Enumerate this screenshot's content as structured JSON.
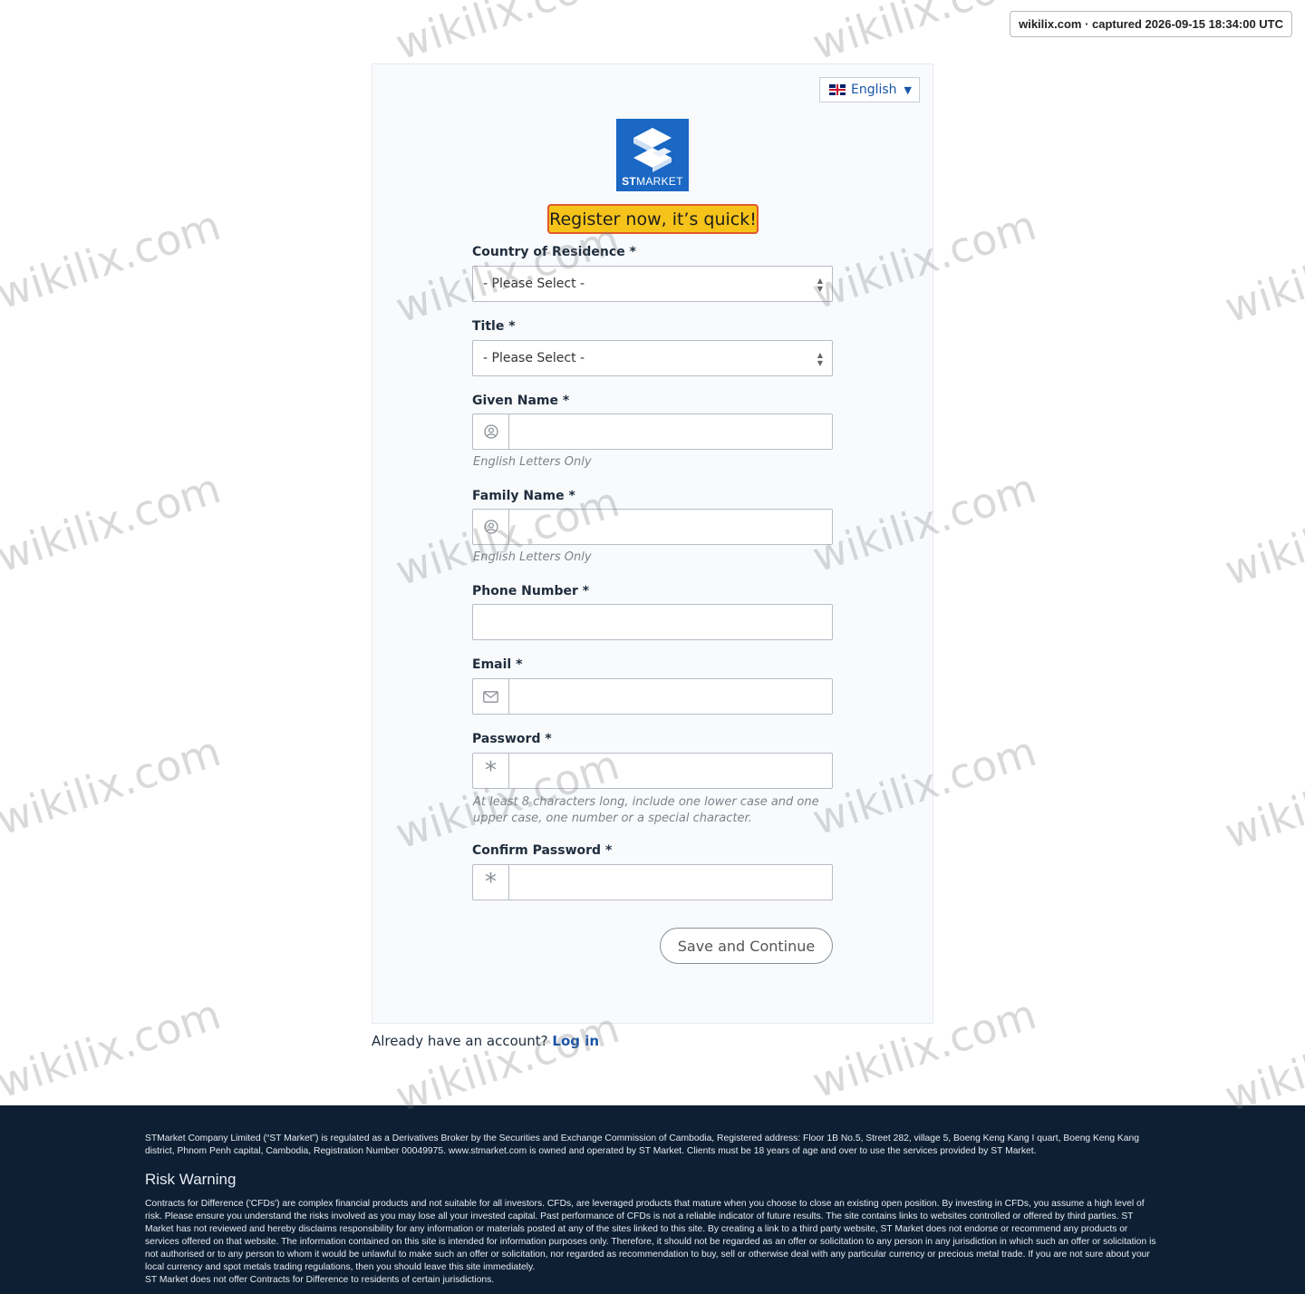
{
  "capture_stamp": "wikilix.com · captured 2026-09-15 18:34:00 UTC",
  "language": {
    "selected": "English",
    "icon": "uk-flag-icon"
  },
  "logo": {
    "brand_bold": "ST",
    "brand_rest": "MARKET"
  },
  "headline": "Register now, it’s quick!",
  "form": {
    "country": {
      "label": "Country of Residence *",
      "value": "- Please Select -"
    },
    "title": {
      "label": "Title *",
      "value": "- Please Select -"
    },
    "given_name": {
      "label": "Given Name *",
      "value": "",
      "hint": "English Letters Only",
      "icon": "user-circle-icon"
    },
    "family_name": {
      "label": "Family Name *",
      "value": "",
      "hint": "English Letters Only",
      "icon": "user-circle-icon"
    },
    "phone": {
      "label": "Phone Number *",
      "value": ""
    },
    "email": {
      "label": "Email *",
      "value": "",
      "icon": "envelope-icon"
    },
    "password": {
      "label": "Password *",
      "value": "",
      "icon": "asterisk-icon",
      "hint": "At least 8 characters long, include one lower case and one upper case, one number or a special character."
    },
    "confirm_password": {
      "label": "Confirm Password *",
      "value": "",
      "icon": "asterisk-icon"
    },
    "submit_label": "Save and Continue"
  },
  "login": {
    "prompt": "Already have an account?",
    "link": "Log in"
  },
  "footer": {
    "regulation": "STMarket Company Limited (“ST Market”) is regulated as a Derivatives Broker by the Securities and Exchange Commission of Cambodia, Registered address: Floor 1B No.5, Street 282, village 5, Boeng Keng Kang I quart, Boeng Keng Kang district, Phnom Penh capital, Cambodia, Registration Number 00049975. www.stmarket.com is owned and operated by ST Market. Clients must be 18 years of age and over to use the services provided by ST Market.",
    "risk_title": "Risk Warning",
    "risk_text": "Contracts for Difference ('CFDs') are complex financial products and not suitable for all investors. CFDs, are leveraged products that mature when you choose to close an existing open position. By investing in CFDs, you assume a high level of risk. Please ensure you understand the risks involved as you may lose all your invested capital. Past performance of CFDs is not a reliable indicator of future results. The site contains links to websites controlled or offered by third parties. ST Market has not reviewed and hereby disclaims responsibility for any information or materials posted at any of the sites linked to this site. By creating a link to a third party website, ST Market does not endorse or recommend any products or services offered on that website. The information contained on this site is intended for information purposes only. Therefore, it should not be regarded as an offer or solicitation to any person in any jurisdiction in which such an offer or solicitation is not authorised or to any person to whom it would be unlawful to make such an offer or solicitation, nor regarded as recommendation to buy, sell or otherwise deal with any particular currency or precious metal trade. If you are not sure about your local currency and spot metals trading regulations, then you should leave this site immediately.",
    "jurisdiction_note": "ST Market does not offer Contracts for Difference to residents of certain jurisdictions."
  },
  "watermark_text": "wikilix.com",
  "colors": {
    "accent": "#1a56a6",
    "headline_bg": "#f6c31a",
    "headline_border": "#e05a2b",
    "footer_bg": "#0e1f33",
    "logo_bg": "#1a67c4"
  }
}
